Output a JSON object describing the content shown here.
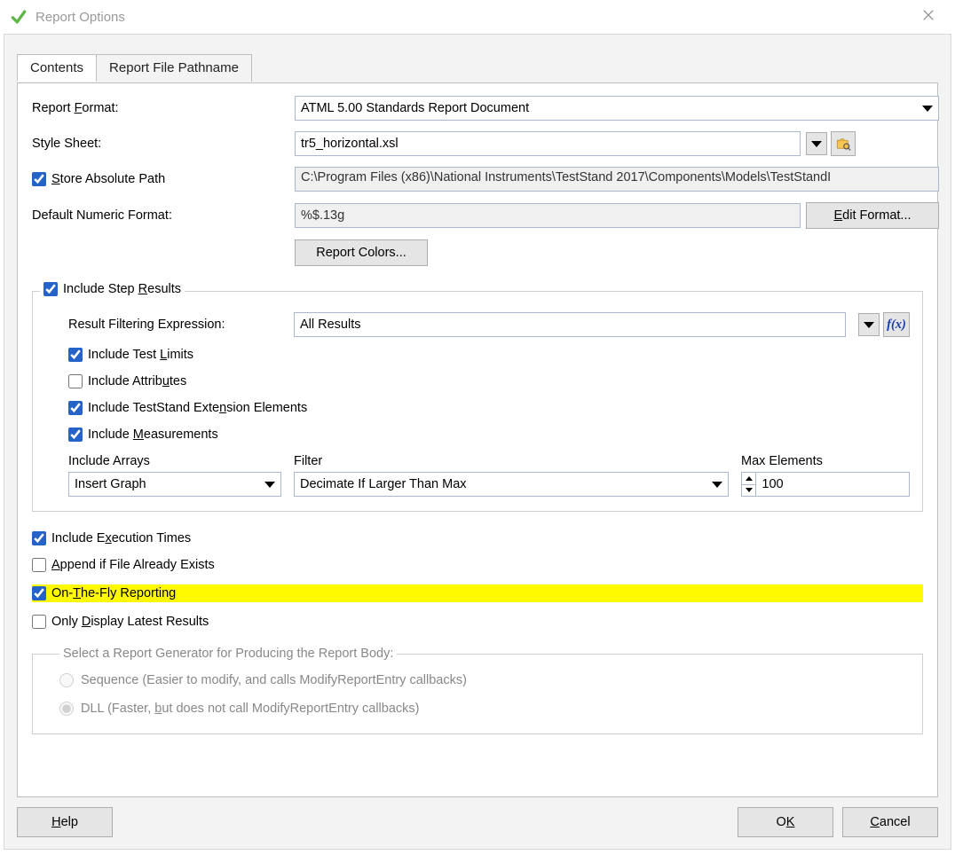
{
  "window": {
    "title": "Report Options"
  },
  "tabs": {
    "contents": "Contents",
    "pathname": "Report File Pathname"
  },
  "form": {
    "report_format_label": "Report Format:",
    "report_format_value": "ATML 5.00 Standards Report Document",
    "style_sheet_label": "Style Sheet:",
    "style_sheet_value": "tr5_horizontal.xsl",
    "store_abs_path_label": "Store Absolute Path",
    "store_abs_path_value": "C:\\Program Files (x86)\\National Instruments\\TestStand 2017\\Components\\Models\\TestStandI",
    "default_num_fmt_label": "Default Numeric Format:",
    "default_num_fmt_value": "%$.13g",
    "edit_format_btn": "Edit Format...",
    "report_colors_btn": "Report Colors..."
  },
  "step_results": {
    "legend": "Include Step Results",
    "filter_label": "Result Filtering Expression:",
    "filter_value": "All Results",
    "inc_test_limits": "Include Test Limits",
    "inc_attributes": "Include Attributes",
    "inc_teststand_ext": "Include TestStand Extension Elements",
    "inc_measurements": "Include Measurements",
    "include_arrays_label": "Include Arrays",
    "include_arrays_value": "Insert Graph",
    "filter2_label": "Filter",
    "filter2_value": "Decimate If Larger Than Max",
    "max_elements_label": "Max Elements",
    "max_elements_value": "100"
  },
  "lower": {
    "inc_exec_times": "Include Execution Times",
    "append_if_exists": "Append if File Already Exists",
    "on_the_fly": "On-The-Fly Reporting",
    "only_latest": "Only Display Latest Results"
  },
  "generator": {
    "legend": "Select a Report Generator for Producing the Report Body:",
    "seq": "Sequence (Easier to modify, and calls ModifyReportEntry callbacks)",
    "dll": "DLL (Faster, but does not call ModifyReportEntry callbacks)"
  },
  "footer": {
    "help": "Help",
    "ok": "OK",
    "cancel": "Cancel"
  }
}
